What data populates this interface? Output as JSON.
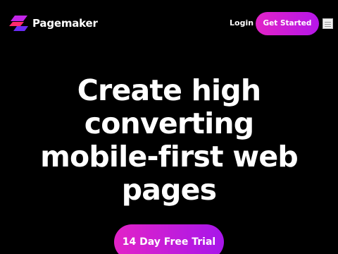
{
  "brand": {
    "name": "Pagemaker",
    "logo_icon": "pagemaker-logo-icon"
  },
  "nav": {
    "login_label": "Login",
    "cta_label": "Get Started",
    "menu_icon": "hamburger-menu-icon"
  },
  "hero": {
    "title_lines": [
      "Create high",
      "converting",
      "mobile-first web",
      "pages"
    ],
    "cta_label": "14 Day Free Trial"
  },
  "colors": {
    "background": "#000000",
    "text": "#ffffff",
    "gradient_start": "#e223c7",
    "gradient_end": "#a716ea",
    "logo_primary": "#c325e8",
    "logo_secondary": "#ff2a6d",
    "logo_tertiary": "#6a2cf5"
  }
}
